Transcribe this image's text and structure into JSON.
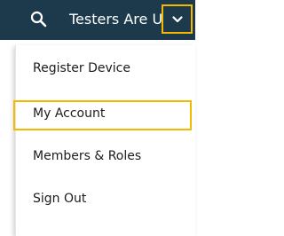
{
  "header": {
    "org_name": "Testers Are Us",
    "search_icon": "search-icon",
    "menu_toggle_icon": "chevron-down-icon"
  },
  "menu": {
    "items": [
      {
        "label": "Register Device"
      },
      {
        "label": "My Account"
      },
      {
        "label": "Members & Roles"
      },
      {
        "label": "Sign Out"
      }
    ]
  },
  "colors": {
    "header_bg": "#1d3a4c",
    "highlight": "#f5b800",
    "menu_text": "#1c1c1c"
  }
}
